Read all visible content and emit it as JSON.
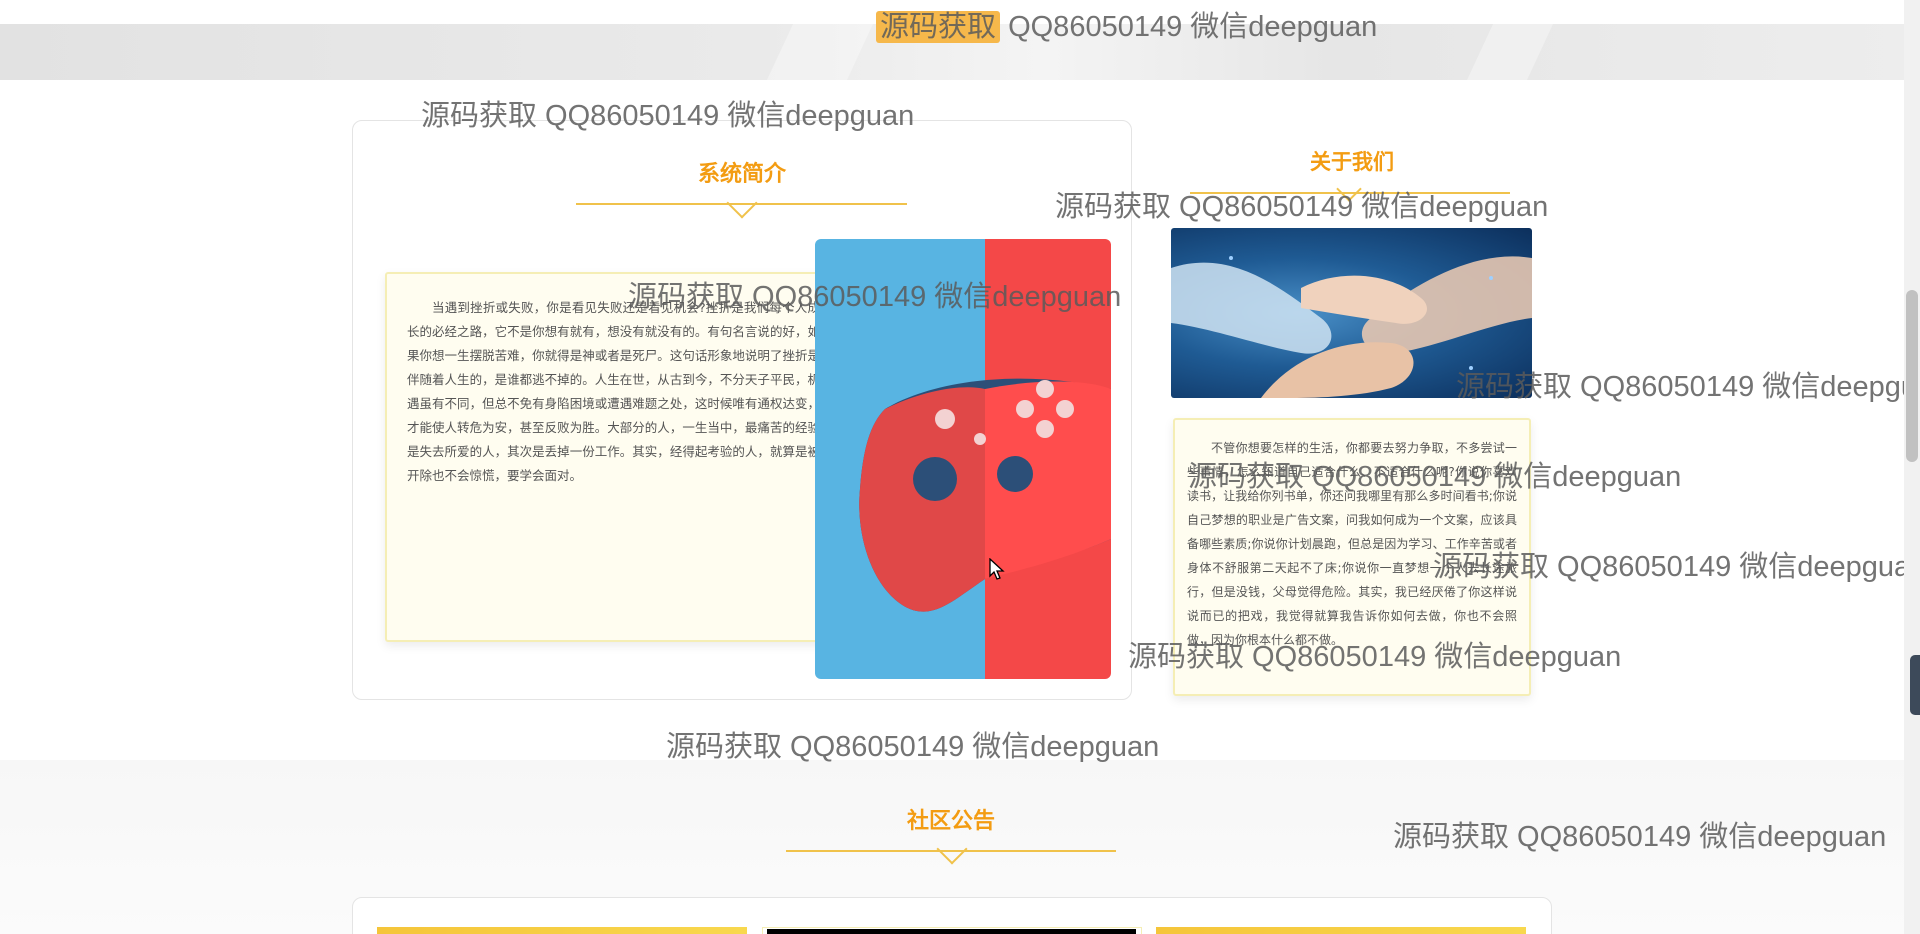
{
  "intro": {
    "title": "系统简介",
    "body": "当遇到挫折或失败，你是看见失败还是看见机会?挫折是我们每个人成长的必经之路，它不是你想有就有，想没有就没有的。有句名言说的好，如果你想一生摆脱苦难，你就得是神或者是死尸。这句话形象地说明了挫折是伴随着人生的，是谁都逃不掉的。人生在世，从古到今，不分天子平民，机遇虽有不同，但总不免有身陷困境或遭遇难题之处，这时候唯有通权达变，才能使人转危为安，甚至反败为胜。大部分的人，一生当中，最痛苦的经验是失去所爱的人，其次是丢掉一份工作。其实，经得起考验的人，就算是被开除也不会惊慌，要学会面对。"
  },
  "about": {
    "title": "关于我们",
    "body": "不管你想要怎样的生活，你都要去努力争取，不多尝试一些事情，怎么知道自己适合什么、不适合什么呢?你说你喜欢读书，让我给你列书单，你还问我哪里有那么多时间看书;你说自己梦想的职业是广告文案，问我如何成为一个文案，应该具备哪些素质;你说你计划晨跑，但总是因为学习、工作辛苦或者身体不舒服第二天起不了床;你说你一直梦想一个人去长途旅行，但是没钱，父母觉得危险。其实，我已经厌倦了你这样说说而已的把戏，我觉得就算我告诉你如何去做，你也不会照做，因为你根本什么都不做。"
  },
  "notice": {
    "title": "社区公告"
  },
  "watermark": {
    "lead": "源码获取",
    "rest": " QQ86050149 微信deepguan",
    "full": "源码获取 QQ86050149 微信deepguan"
  },
  "colors": {
    "accent": "#f39c12",
    "line": "#f0c24b",
    "controller_blue": "#58b4e2",
    "controller_red": "#f44848"
  },
  "icons": {
    "controller_image": "game-controller",
    "hands_image": "teamwork-hands",
    "cursor": "mouse-pointer"
  }
}
